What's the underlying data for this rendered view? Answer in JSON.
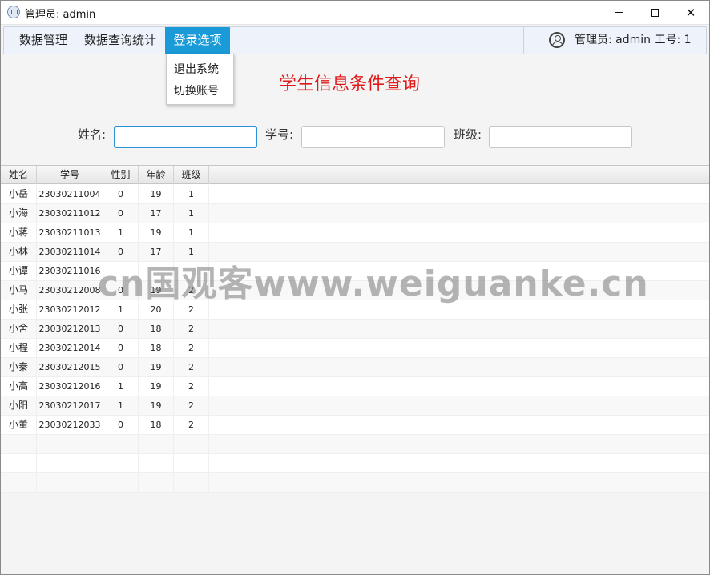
{
  "window": {
    "title": "管理员:  admin",
    "minimize_glyph": "",
    "close_glyph": "✕"
  },
  "menubar": {
    "items": [
      {
        "label": "数据管理"
      },
      {
        "label": "数据查询统计"
      },
      {
        "label": "登录选项"
      }
    ],
    "active_index": 2,
    "user_text": "管理员: admin 工号: 1",
    "user_icon": "user-circle-icon"
  },
  "dropdown": {
    "items": [
      {
        "label": "退出系统"
      },
      {
        "label": "切换账号"
      }
    ]
  },
  "page": {
    "title": "学生信息条件查询"
  },
  "search": {
    "name_label": "姓名:",
    "name_value": "",
    "id_label": "学号:",
    "id_value": "",
    "class_label": "班级:",
    "class_value": ""
  },
  "table": {
    "headers": [
      "姓名",
      "学号",
      "性别",
      "年龄",
      "班级"
    ],
    "rows": [
      [
        "小岳",
        "23030211004",
        "0",
        "19",
        "1"
      ],
      [
        "小海",
        "23030211012",
        "0",
        "17",
        "1"
      ],
      [
        "小蒋",
        "23030211013",
        "1",
        "19",
        "1"
      ],
      [
        "小林",
        "23030211014",
        "0",
        "17",
        "1"
      ],
      [
        "小谭",
        "23030211016",
        "",
        "",
        ""
      ],
      [
        "小马",
        "23030212008",
        "0",
        "19",
        "2"
      ],
      [
        "小张",
        "23030212012",
        "1",
        "20",
        "2"
      ],
      [
        "小舍",
        "23030212013",
        "0",
        "18",
        "2"
      ],
      [
        "小程",
        "23030212014",
        "0",
        "18",
        "2"
      ],
      [
        "小秦",
        "23030212015",
        "0",
        "19",
        "2"
      ],
      [
        "小高",
        "23030212016",
        "1",
        "19",
        "2"
      ],
      [
        "小阳",
        "23030212017",
        "1",
        "19",
        "2"
      ],
      [
        "小董",
        "23030212033",
        "0",
        "18",
        "2"
      ]
    ],
    "empty_rows": 3
  },
  "watermark": "cn国观客www.weiguanke.cn",
  "colors": {
    "accent": "#1a9ad6",
    "title_red": "#e01a1a",
    "menubar_bg": "#eef3fb"
  }
}
